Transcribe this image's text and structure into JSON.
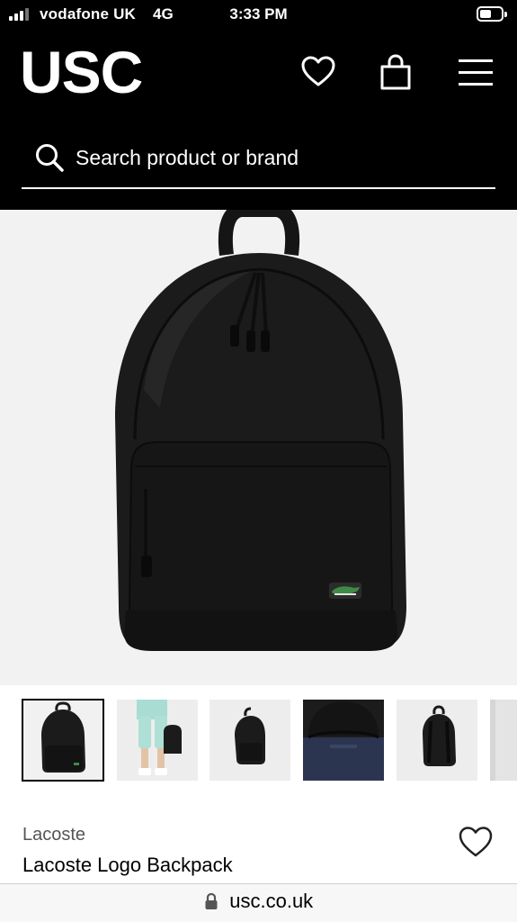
{
  "status_bar": {
    "carrier": "vodafone UK",
    "network": "4G",
    "time": "3:33 PM"
  },
  "header": {
    "logo": "USC",
    "icons": [
      "heart-icon",
      "shopping-bag-icon",
      "hamburger-menu-icon"
    ],
    "search": {
      "placeholder": "Search product or brand",
      "value": ""
    }
  },
  "product": {
    "brand": "Lacoste",
    "name": "Lacoste Logo Backpack",
    "main_image": "black-backpack-front",
    "thumbnails": [
      {
        "name": "backpack-front",
        "selected": true
      },
      {
        "name": "model-wearing-backpack",
        "selected": false
      },
      {
        "name": "backpack-angle",
        "selected": false
      },
      {
        "name": "backpack-open-interior",
        "selected": false
      },
      {
        "name": "backpack-back-straps",
        "selected": false
      },
      {
        "name": "backpack-partial",
        "selected": false
      }
    ]
  },
  "browser": {
    "url": "usc.co.uk"
  },
  "colors": {
    "header_bg": "#000000",
    "hero_bg": "#f2f2f2",
    "text": "#000000",
    "brand_text": "#555555"
  }
}
